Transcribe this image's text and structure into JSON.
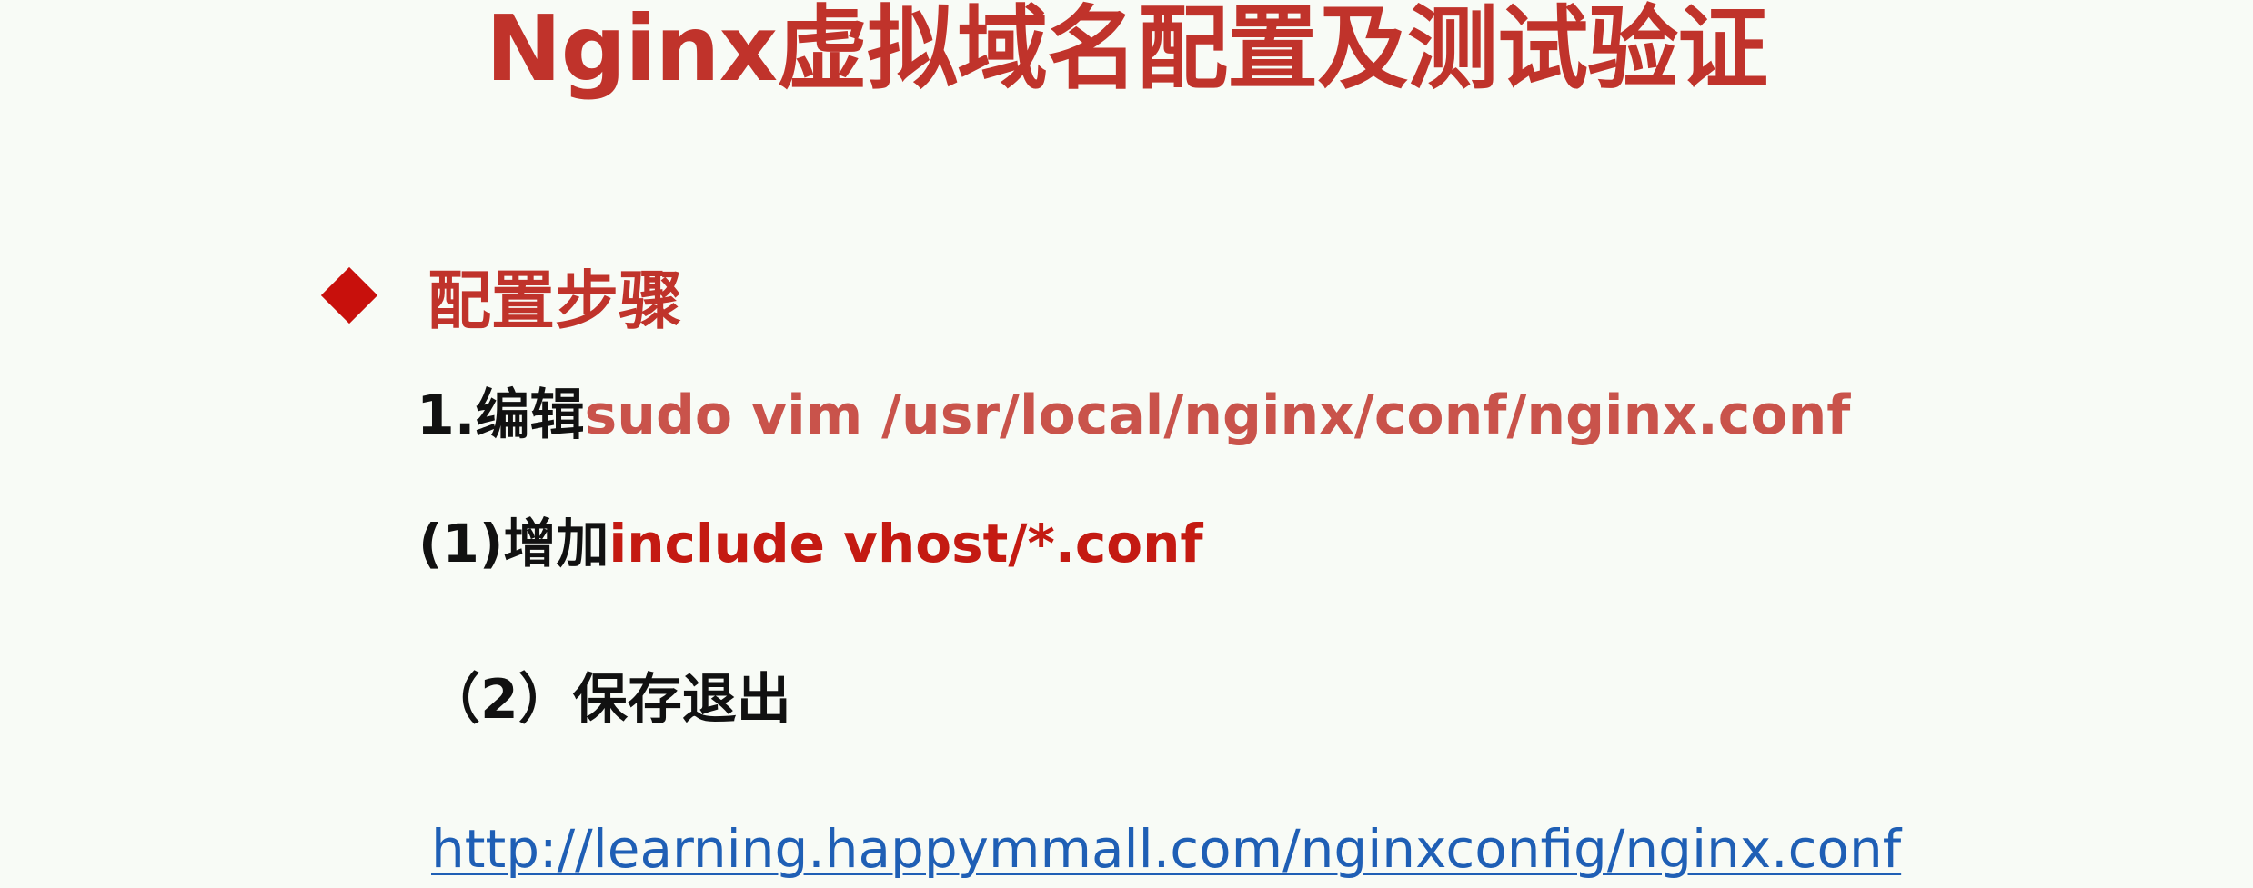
{
  "title": "Nginx虚拟域名配置及测试验证",
  "section": {
    "heading": "配置步骤",
    "steps": [
      {
        "label": "1.编辑",
        "command": "sudo vim /usr/local/nginx/conf/nginx.conf"
      },
      {
        "label": "(1)增加",
        "command": "include vhost/*.conf"
      },
      {
        "label": "（2）保存退出",
        "command": ""
      }
    ],
    "link": "http://learning.happymmall.com/nginxconfig/nginx.conf"
  },
  "colors": {
    "title": "#c0332b",
    "bullet": "#c8100c",
    "command_primary": "#c9534b",
    "command_secondary": "#c41a12",
    "link": "#1f5fb5",
    "background": "#f8fbf6"
  },
  "icons": {
    "bullet": "diamond-bullet-icon"
  }
}
